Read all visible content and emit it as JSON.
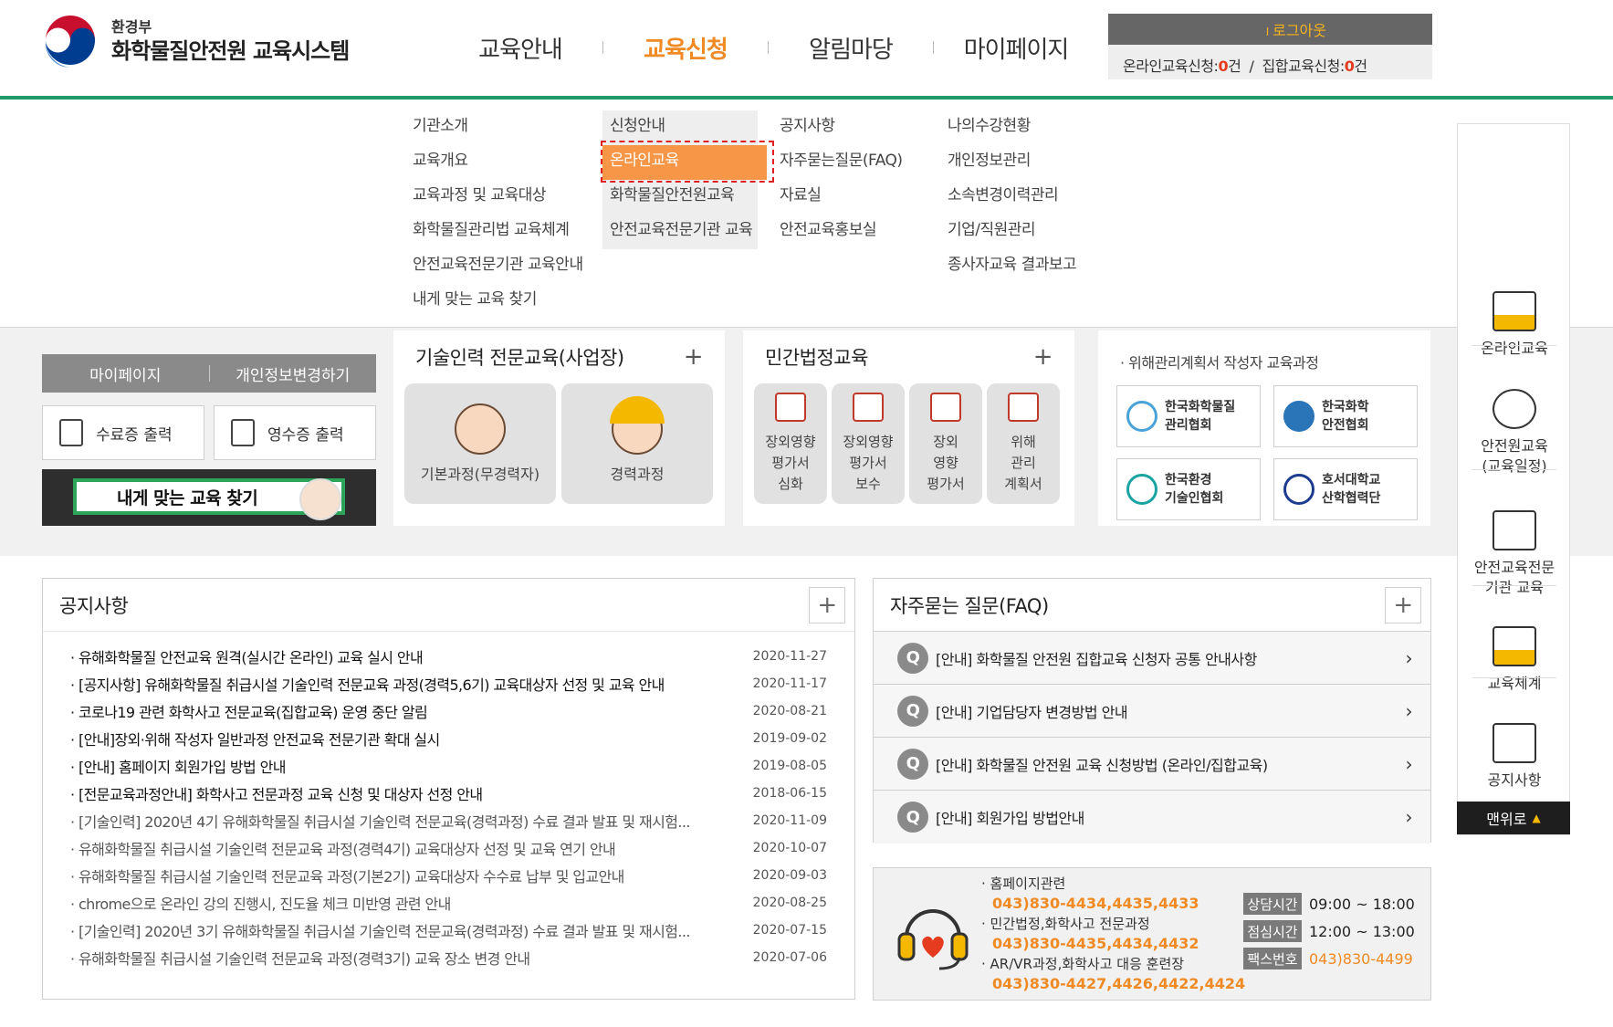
{
  "header": {
    "ministry": "환경부",
    "system_name": "화학물질안전원 교육시스템",
    "gnb": [
      {
        "label": "교육안내"
      },
      {
        "label": "교육신청"
      },
      {
        "label": "알림마당"
      },
      {
        "label": "마이페이지"
      }
    ],
    "logout_label": "로그아웃",
    "online_apply_label": "온라인교육신청:",
    "online_apply_count": "0",
    "group_apply_label": "집합교육신청:",
    "group_apply_count": "0",
    "count_unit": "건"
  },
  "mega_menu": {
    "guide": [
      "기관소개",
      "교육개요",
      "교육과정 및 교육대상",
      "화학물질관리법 교육체계",
      "안전교육전문기관 교육안내",
      "내게 맞는 교육 찾기"
    ],
    "apply": [
      "신청안내",
      "온라인교육",
      "화학물질안전원교육",
      "안전교육전문기관 교육"
    ],
    "notice": [
      "공지사항",
      "자주묻는질문(FAQ)",
      "자료실",
      "안전교육홍보실"
    ],
    "mypage": [
      "나의수강현황",
      "개인정보관리",
      "소속변경이력관리",
      "기업/직원관리",
      "종사자교육 결과보고"
    ]
  },
  "my_box": {
    "tab_mypage": "마이페이지",
    "tab_info": "개인정보변경하기",
    "certificate": "수료증 출력",
    "receipt": "영수증 출력",
    "find": "내게 맞는 교육 찾기"
  },
  "tech_panel": {
    "title": "기술인력 전문교육(사업장)",
    "plus": "+",
    "cards": [
      "기본과정(무경력자)",
      "경력과정"
    ]
  },
  "civil_panel": {
    "title": "민간법정교육",
    "plus": "+",
    "cards": [
      "장외영향\n평가서\n심화",
      "장외영향\n평가서\n보수",
      "장외\n영향\n평가서",
      "위해\n관리\n계획서"
    ]
  },
  "inst_panel": {
    "title": "위해관리계획서 작성자 교육과정",
    "cards": [
      {
        "line1": "한국화학물질",
        "line2": "관리협회"
      },
      {
        "line1": "한국화학",
        "line2": "안전협회"
      },
      {
        "line1": "한국환경",
        "line2": "기술인협회"
      },
      {
        "line1": "호서대학교",
        "line2": "산학협력단"
      }
    ]
  },
  "quick": {
    "items": [
      "온라인교육",
      "안전원교육\n(교육일정)",
      "안전교육전문\n기관 교육",
      "교육체계",
      "공지사항"
    ],
    "top": "맨위로"
  },
  "notice": {
    "title": "공지사항",
    "plus": "+",
    "rows": [
      {
        "title": "유해화학물질 안전교육 원격(실시간 온라인) 교육 실시 안내",
        "date": "2020-11-27",
        "bold": true
      },
      {
        "title": "[공지사항] 유해화학물질 취급시설 기술인력 전문교육 과정(경력5,6기) 교육대상자 선정 및 교육 안내",
        "date": "2020-11-17",
        "bold": true
      },
      {
        "title": "코로나19 관련 화학사고 전문교육(집합교육) 운영 중단 알림",
        "date": "2020-08-21",
        "bold": true
      },
      {
        "title": "[안내]장외·위해 작성자 일반과정 안전교육 전문기관 확대 실시",
        "date": "2019-09-02",
        "bold": true
      },
      {
        "title": "[안내] 홈페이지 회원가입 방법 안내",
        "date": "2019-08-05",
        "bold": true
      },
      {
        "title": "[전문교육과정안내] 화학사고 전문과정 교육 신청 및 대상자 선정 안내",
        "date": "2018-06-15",
        "bold": true
      },
      {
        "title": "[기술인력] 2020년 4기 유해화학물질 취급시설 기술인력 전문교육(경력과정) 수료 결과 발표 및 재시험...",
        "date": "2020-11-09",
        "bold": false
      },
      {
        "title": "유해화학물질 취급시설 기술인력 전문교육 과정(경력4기) 교육대상자 선정 및 교육 연기 안내",
        "date": "2020-10-07",
        "bold": false
      },
      {
        "title": "유해화학물질 취급시설 기술인력 전문교육 과정(기본2기) 교육대상자 수수료 납부 및 입교안내",
        "date": "2020-09-03",
        "bold": false
      },
      {
        "title": "chrome으로 온라인 강의 진행시, 진도율 체크 미반영 관련 안내",
        "date": "2020-08-25",
        "bold": false
      },
      {
        "title": "[기술인력] 2020년 3기 유해화학물질 취급시설 기술인력 전문교육(경력과정) 수료 결과 발표 및 재시험...",
        "date": "2020-07-15",
        "bold": false
      },
      {
        "title": "유해화학물질 취급시설 기술인력 전문교육 과정(경력3기) 교육 장소 변경 안내",
        "date": "2020-07-06",
        "bold": false
      }
    ]
  },
  "faq": {
    "title": "자주묻는 질문(FAQ)",
    "plus": "+",
    "q": "Q",
    "rows": [
      "[안내] 화학물질 안전원 집합교육 신청자 공통 안내사항",
      "[안내] 기업담당자 변경방법 안내",
      "[안내] 화학물질 안전원 교육 신청방법 (온라인/집합교육)",
      "[안내] 회원가입 방법안내"
    ]
  },
  "contact": {
    "groups": [
      {
        "label": "홈페이지관련",
        "number": "043)830-4434,4435,4433"
      },
      {
        "label": "민간법정,화학사고 전문과정",
        "number": "043)830-4435,4434,4432"
      },
      {
        "label": "AR/VR과정,화학사고 대응 훈련장",
        "number": "043)830-4427,4426,4422,4424"
      }
    ],
    "hours": [
      {
        "tag": "상담시간",
        "value": "09:00 ~ 18:00"
      },
      {
        "tag": "점심시간",
        "value": "12:00 ~ 13:00"
      },
      {
        "tag": "팩스번호",
        "value": "043)830-4499"
      }
    ]
  },
  "colors": {
    "accent": "#f08a24",
    "green_line": "#1f9a6a",
    "highlight_outline": "#e02020"
  }
}
